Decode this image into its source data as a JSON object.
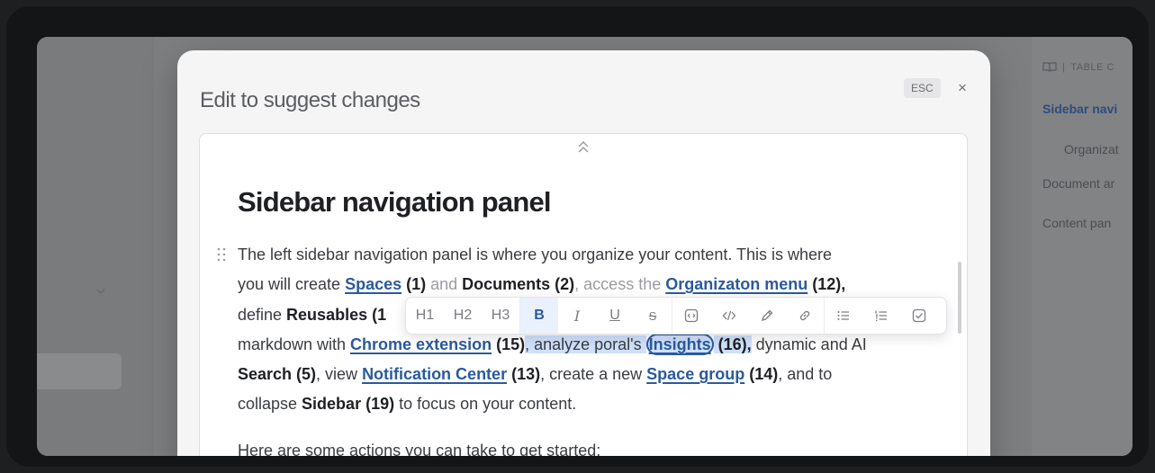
{
  "modal": {
    "title": "Edit to suggest changes",
    "esc_label": "ESC",
    "close_glyph": "×"
  },
  "document": {
    "heading": "Sidebar navigation panel",
    "paragraph_1": {
      "l1": "The left sidebar navigation panel is where you organize your content. This is where",
      "l2_a": "you will create ",
      "l2_spaces": "Spaces",
      "l2_b": " (1)",
      "l2_c": " and ",
      "l2_documents": "Documents (2)",
      "l2_d": ", access the ",
      "l2_org": "Organizaton menu",
      "l2_e": " (12),",
      "l3_a": "define ",
      "l3_reusables": "Reusables (1",
      "l4_a": "markdown with ",
      "l4_chrome": "Chrome extension",
      "l4_b": " (15)",
      "l4_c": ", analyze poral's ",
      "l4_insights": "Insights",
      "l4_d": " (16),",
      "l4_e": " dynamic and AI",
      "l5_search": "Search (5)",
      "l5_a": ", view ",
      "l5_notif": "Notification Center",
      "l5_b": " (13)",
      "l5_c": ", create a new ",
      "l5_spacegroup": "Space group",
      "l5_d": " (14)",
      "l5_e": ", and to",
      "l6_a": "collapse ",
      "l6_sidebar": "Sidebar (19)",
      "l6_b": " to focus on your content."
    },
    "paragraph_2": "Here are some actions you can take to get started:"
  },
  "toolbar": {
    "h1": "H1",
    "h2": "H2",
    "h3": "H3",
    "bold": "B",
    "italic": "I",
    "underline": "U",
    "strike": "S"
  },
  "toc": {
    "header": "TABLE C",
    "items": [
      {
        "label": "Sidebar navi"
      },
      {
        "label": "Organizat"
      },
      {
        "label": "Document ar"
      },
      {
        "label": "Content pan"
      }
    ]
  },
  "colors": {
    "accent": "#2b5a9e",
    "selection": "#cfe0fb"
  }
}
